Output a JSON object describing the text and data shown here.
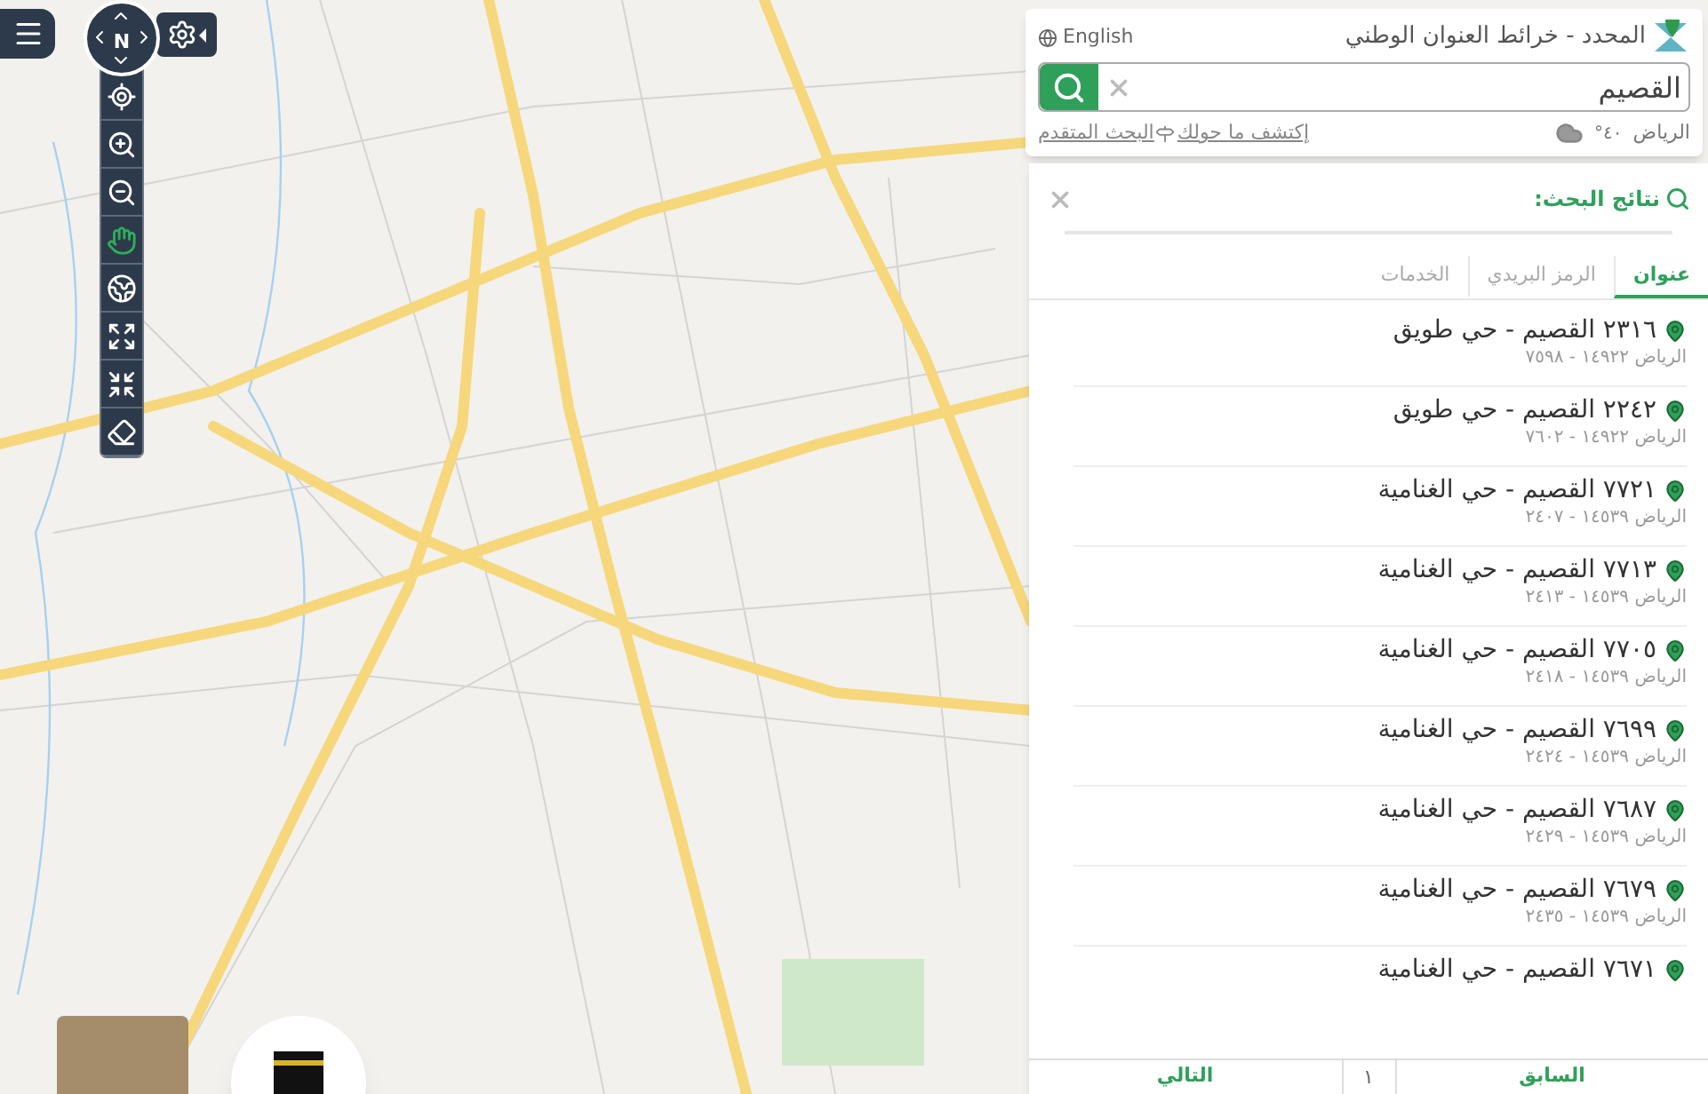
{
  "map_controls": {
    "compass_label": "N",
    "tools": [
      {
        "kind": "locate",
        "selected": false
      },
      {
        "kind": "zoom-in",
        "selected": false
      },
      {
        "kind": "zoom-out",
        "selected": false
      },
      {
        "kind": "pan",
        "selected": true
      },
      {
        "kind": "globe",
        "selected": false
      },
      {
        "kind": "expand",
        "selected": false
      },
      {
        "kind": "shrink",
        "selected": false
      },
      {
        "kind": "eraser",
        "selected": false
      }
    ]
  },
  "header": {
    "title": "المحدد - خرائط العنوان الوطني",
    "language": "English",
    "search": {
      "value": "القصيم"
    },
    "weather": {
      "city": "الرياض",
      "temperature": "٤٠°"
    },
    "links": [
      "إكتشف ما حولك",
      "البحث المتقدم"
    ]
  },
  "results": {
    "title": "نتائج البحث:",
    "tabs": [
      {
        "label": "عنوان",
        "selected": true
      },
      {
        "label": "الرمز البريدي",
        "selected": false
      },
      {
        "label": "الخدمات",
        "selected": false
      }
    ],
    "items": [
      {
        "title": "٢٣١٦ القصيم - حي طويق",
        "subtitle": "الرياض ١٤٩٢٢ - ٧٥٩٨"
      },
      {
        "title": "٢٢٤٢ القصيم - حي طويق",
        "subtitle": "الرياض ١٤٩٢٢ - ٧٦٠٢"
      },
      {
        "title": "٧٧٢١ القصيم - حي الغنامية",
        "subtitle": "الرياض ١٤٥٣٩ - ٢٤٠٧"
      },
      {
        "title": "٧٧١٣ القصيم - حي الغنامية",
        "subtitle": "الرياض ١٤٥٣٩ - ٢٤١٣"
      },
      {
        "title": "٧٧٠٥ القصيم - حي الغنامية",
        "subtitle": "الرياض ١٤٥٣٩ - ٢٤١٨"
      },
      {
        "title": "٧٦٩٩ القصيم - حي الغنامية",
        "subtitle": "الرياض ١٤٥٣٩ - ٢٤٢٤"
      },
      {
        "title": "٧٦٨٧ القصيم - حي الغنامية",
        "subtitle": "الرياض ١٤٥٣٩ - ٢٤٢٩"
      },
      {
        "title": "٧٦٧٩ القصيم - حي الغنامية",
        "subtitle": "الرياض ١٤٥٣٩ - ٢٤٣٥"
      },
      {
        "title": "٧٦٧١ القصيم - حي الغنامية"
      }
    ],
    "pagination": {
      "previous": "السابق",
      "page": "١",
      "next": "التالي"
    }
  }
}
